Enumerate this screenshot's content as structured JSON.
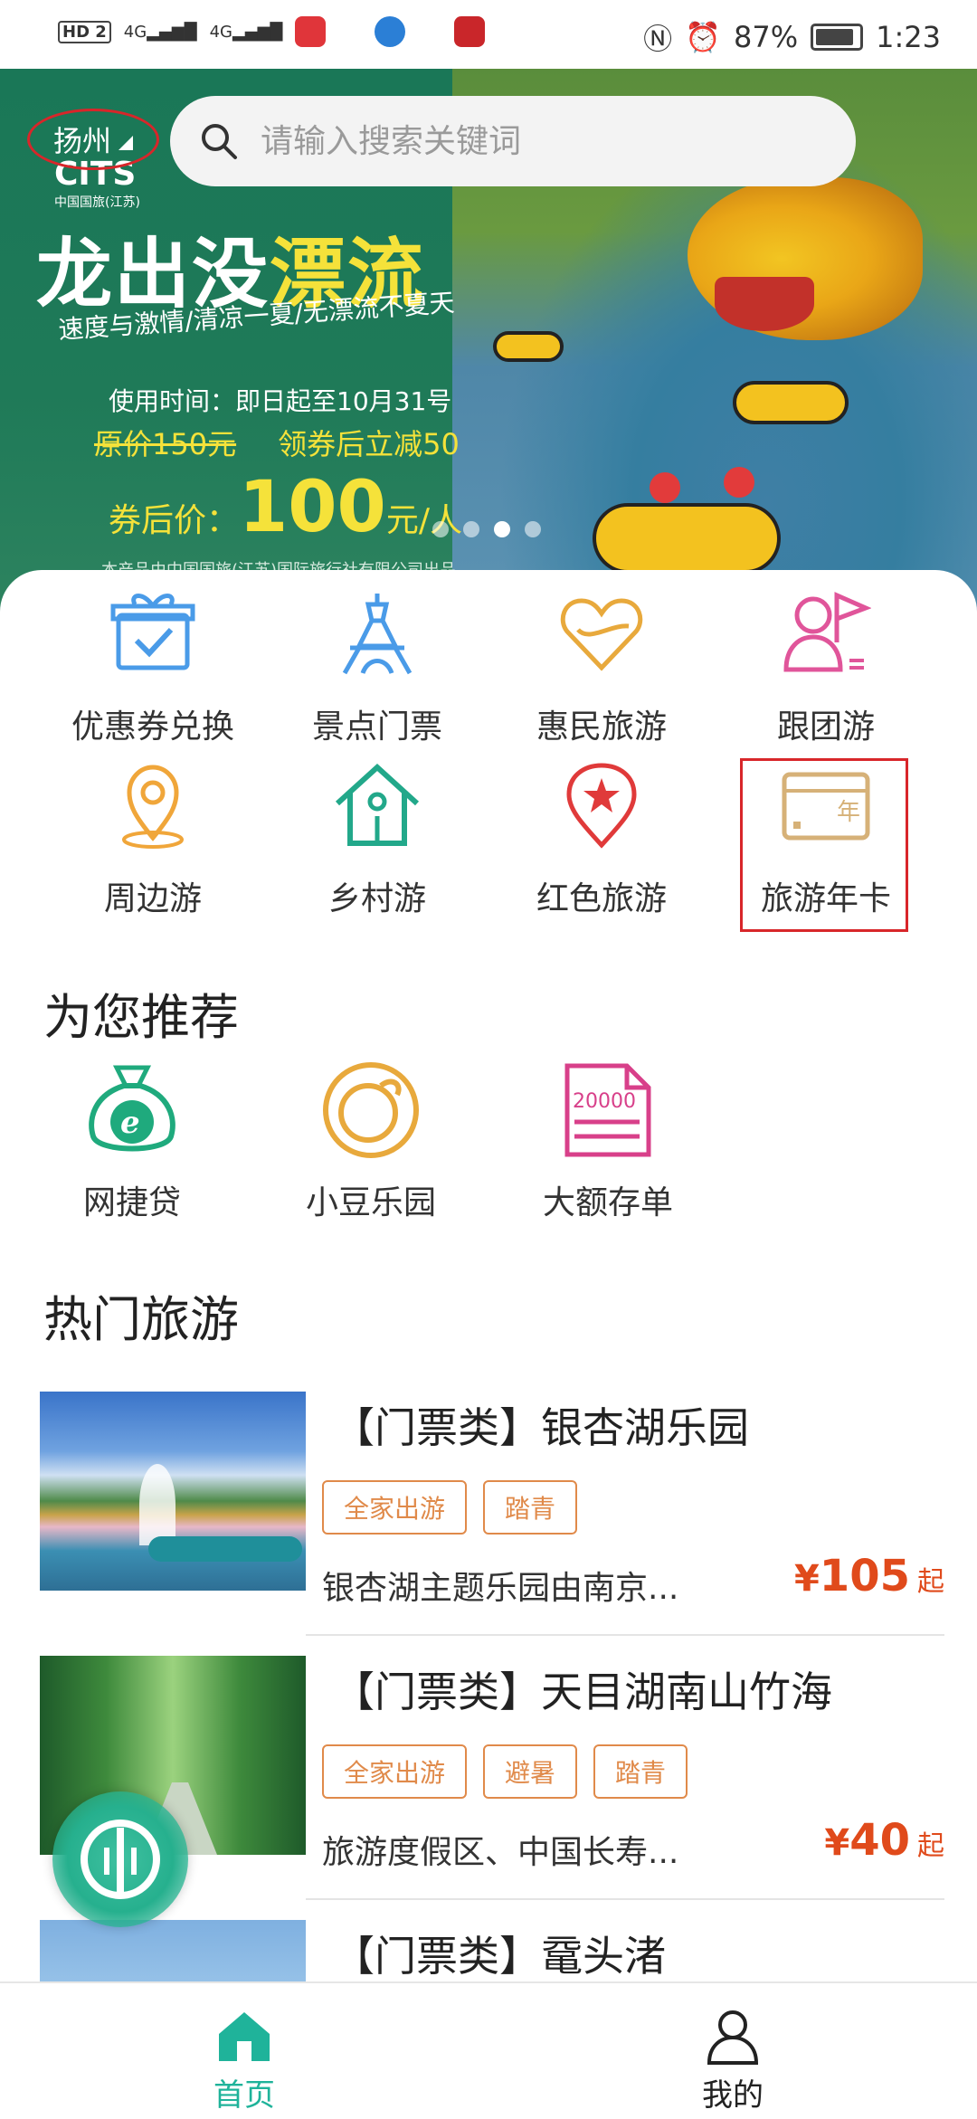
{
  "status_bar": {
    "network_left": "HD 2",
    "signal1": "4G",
    "signal2": "4G",
    "battery": "87%",
    "time": "1:23"
  },
  "header": {
    "city": "扬州",
    "search_placeholder": "请输入搜索关键词"
  },
  "banner": {
    "brand": "CITS",
    "brand_sub": "中国国旅(江苏)",
    "title_part1": "龙出没",
    "title_part2": "漂流",
    "slogan": "速度与激情/清凉一夏/无漂流不夏天",
    "date": "使用时间：即日起至10月31号",
    "original_price": "原价150元",
    "discount": "领券后立减50",
    "final_prefix": "券后价：",
    "final_price": "100",
    "final_unit": "元/人",
    "footnote": "本产品由中国国旅(江苏)国际旅行社有限公司出品",
    "active_slide": 3,
    "slide_count": 4
  },
  "categories": [
    {
      "label": "优惠券兑换",
      "icon": "gift-coupon-icon",
      "color": "#4a9be8"
    },
    {
      "label": "景点门票",
      "icon": "tower-icon",
      "color": "#4a9be8"
    },
    {
      "label": "惠民旅游",
      "icon": "heart-icon",
      "color": "#e8a93c"
    },
    {
      "label": "跟团游",
      "icon": "person-flag-icon",
      "color": "#e0559a"
    },
    {
      "label": "周边游",
      "icon": "location-pin-icon",
      "color": "#f0a63a"
    },
    {
      "label": "乡村游",
      "icon": "house-icon",
      "color": "#22a88a"
    },
    {
      "label": "红色旅游",
      "icon": "star-pin-icon",
      "color": "#e03a3a"
    },
    {
      "label": "旅游年卡",
      "icon": "annual-card-icon",
      "color": "#d6b178",
      "card_char": "年"
    }
  ],
  "recommend": {
    "title": "为您推荐",
    "items": [
      {
        "label": "网捷贷",
        "icon": "money-bag-icon",
        "color": "#1faa7d",
        "glyph": "e"
      },
      {
        "label": "小豆乐园",
        "icon": "bean-circle-icon",
        "color": "#e8a93c"
      },
      {
        "label": "大额存单",
        "icon": "deposit-doc-icon",
        "color": "#d8408a",
        "glyph": "20000"
      }
    ]
  },
  "hot": {
    "title": "热门旅游",
    "items": [
      {
        "title": "【门票类】银杏湖乐园",
        "tags": [
          "全家出游",
          "踏青"
        ],
        "desc": "银杏湖主题乐园由南京...",
        "currency": "¥",
        "price": "105",
        "suffix": "起"
      },
      {
        "title": "【门票类】天目湖南山竹海",
        "tags": [
          "全家出游",
          "避暑",
          "踏青"
        ],
        "desc": "旅游度假区、中国长寿...",
        "currency": "¥",
        "price": "40",
        "suffix": "起"
      },
      {
        "title": "【门票类】鼋头渚",
        "tags": [],
        "desc": "",
        "currency": "",
        "price": "",
        "suffix": ""
      }
    ]
  },
  "bottom_nav": [
    {
      "label": "首页",
      "icon": "home-icon",
      "active": true,
      "color": "#1fb39a"
    },
    {
      "label": "我的",
      "icon": "user-icon",
      "active": false,
      "color": "#222222"
    }
  ]
}
